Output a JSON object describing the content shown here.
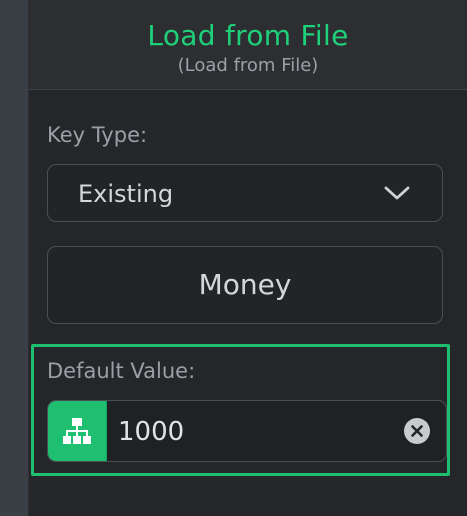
{
  "header": {
    "title": "Load from File",
    "subtitle": "(Load from File)"
  },
  "key_type": {
    "label": "Key Type:",
    "selected": "Existing",
    "key_value": "Money"
  },
  "default_value": {
    "label": "Default Value:",
    "value": "1000",
    "type_icon": "hierarchy-icon",
    "clear_icon": "clear-icon"
  },
  "colors": {
    "accent": "#1fd07a",
    "highlight_border": "#1ec06f"
  }
}
